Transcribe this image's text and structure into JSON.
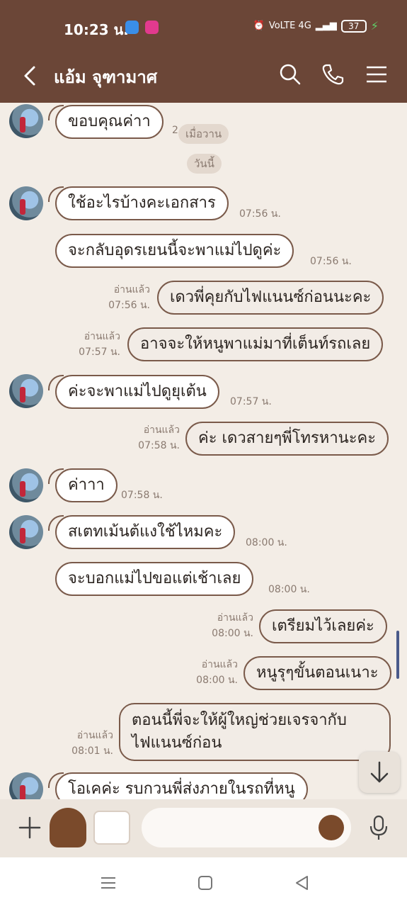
{
  "status_bar": {
    "time": "10:23 น.",
    "network": "VoLTE 4G",
    "battery": "37"
  },
  "header": {
    "title": "แอ้ม จุฑามาศ"
  },
  "chat": {
    "date_chips": [
      "เมื่อวาน",
      "วันนี้"
    ],
    "messages": [
      {
        "dir": "in",
        "text": "ขอบคุณค่าา",
        "time": "2"
      },
      {
        "dir": "in",
        "text": "ใช้อะไรบ้างคะเอกสาร",
        "time": "07:56 น."
      },
      {
        "dir": "in",
        "text": "จะกลับอุดรเยนนี้จะพาแม่ไปดูค่ะ",
        "time": "07:56 น."
      },
      {
        "dir": "out",
        "text": "เดวพี่คุยกับไฟแนนซ์ก่อนนะคะ",
        "read": "อ่านแล้ว",
        "time": "07:56 น."
      },
      {
        "dir": "out",
        "text": "อาจจะให้หนูพาแม่มาที่เต็นท์รถเลย",
        "read": "อ่านแล้ว",
        "time": "07:57 น."
      },
      {
        "dir": "in",
        "text": "ค่ะจะพาแม่ไปดูยุเต้น",
        "time": "07:57 น."
      },
      {
        "dir": "out",
        "text": "ค่ะ เดวสายๆพี่โทรหานะคะ",
        "read": "อ่านแล้ว",
        "time": "07:58 น."
      },
      {
        "dir": "in",
        "text": "ค่าาา",
        "time": "07:58 น."
      },
      {
        "dir": "in",
        "text": "สเตทเม้นต้แงใช้ไหมคะ",
        "time": "08:00 น."
      },
      {
        "dir": "in",
        "text": "จะบอกแม่ไปขอแต่เช้าเลย",
        "time": "08:00 น."
      },
      {
        "dir": "out",
        "text": "เตรียมไว้เลยค่ะ",
        "read": "อ่านแล้ว",
        "time": "08:00 น."
      },
      {
        "dir": "out",
        "text": "หนูรุๆขั้นตอนเนาะ",
        "read": "อ่านแล้ว",
        "time": "08:00 น."
      },
      {
        "dir": "out",
        "text": "ตอนนี้พี่จะให้ผู้ใหญ่ช่วยเจรจากับ\nไฟแนนซ์ก่อน",
        "read": "อ่านแล้ว",
        "time": "08:01 น."
      },
      {
        "dir": "in",
        "text": "โอเคค่ะ รบกวนพี่ส่งภายในรถที่หนู",
        "time": ""
      }
    ]
  },
  "icons": {
    "header": [
      "back-icon",
      "search-icon",
      "phone-icon",
      "menu-icon"
    ],
    "input": [
      "plus-icon",
      "bear-sticker-icon",
      "duck-sticker-icon",
      "emoji-icon",
      "mic-icon"
    ],
    "nav": [
      "recent-apps-icon",
      "home-icon",
      "back-nav-icon"
    ]
  },
  "colors": {
    "header_bg": "#6b4637",
    "chat_bg": "#f3ede6",
    "bubble_border": "#7a5a4a"
  }
}
